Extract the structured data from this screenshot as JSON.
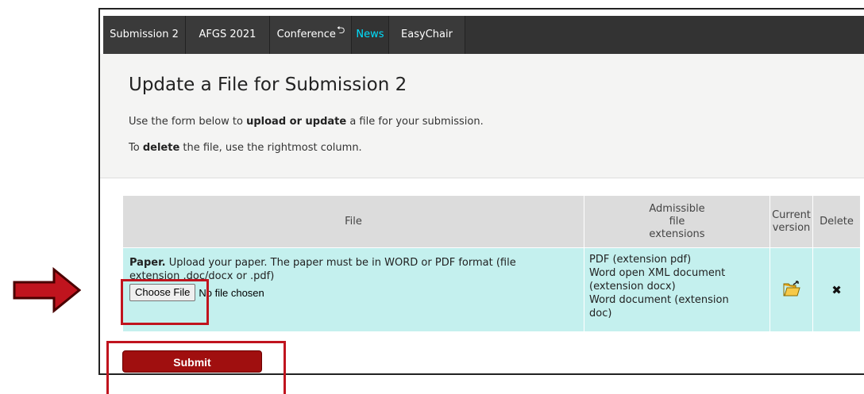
{
  "menu": {
    "items": [
      {
        "label": "Submission 2"
      },
      {
        "label": "AFGS 2021"
      },
      {
        "label": "Conference"
      },
      {
        "label": "News"
      },
      {
        "label": "EasyChair"
      }
    ]
  },
  "page": {
    "title": "Update a File for Submission 2",
    "line1_pre": "Use the form below to ",
    "line1_bold": "upload or update",
    "line1_post": " a file for your submission.",
    "line2_pre": "To ",
    "line2_bold": "delete",
    "line2_post": " the file, use the rightmost column."
  },
  "table": {
    "headers": {
      "file": "File",
      "ext_1": "Admissible",
      "ext_2": "file",
      "ext_3": "extensions",
      "current_1": "Current",
      "current_2": "version",
      "delete": "Delete"
    },
    "row": {
      "name": "Paper.",
      "desc_1": " Upload your paper. The paper must be in WORD or PDF format (file",
      "desc_2": "extension .doc/docx or .pdf)",
      "choose_label": "Choose File",
      "no_file": "No file chosen",
      "ext_1": "PDF (extension pdf)",
      "ext_2": "Word open XML document",
      "ext_3": "(extension docx)",
      "ext_4": "Word document (extension",
      "ext_5": "doc)",
      "current_icon": "open-folder-icon",
      "delete_icon": "close-icon",
      "delete_glyph": "✖"
    }
  },
  "submit_label": "Submit",
  "colors": {
    "menubar": "#333333",
    "news": "#00e0ff",
    "row_bg": "#c4f0ee",
    "submit": "#a00f0f",
    "highlight": "#c0141e"
  }
}
